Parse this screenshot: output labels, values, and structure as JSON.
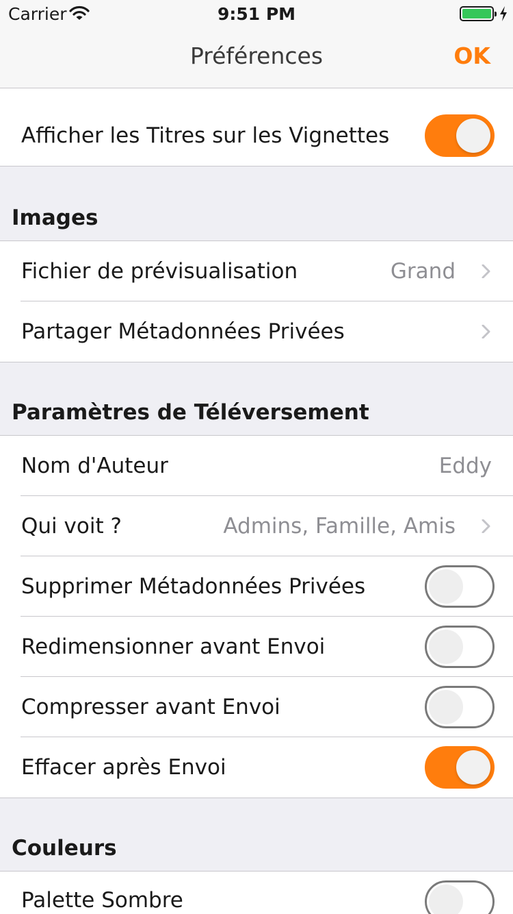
{
  "status_bar": {
    "carrier": "Carrier",
    "time": "9:51 PM",
    "battery_color": "#35c759"
  },
  "nav": {
    "title": "Préférences",
    "ok_label": "OK",
    "accent_color": "#ff7d0d"
  },
  "top_group": {
    "rows": [
      {
        "label": "Afficher les Titres sur les Vignettes",
        "toggle": true
      }
    ]
  },
  "images": {
    "header": "Images",
    "rows": [
      {
        "label": "Fichier de prévisualisation",
        "value": "Grand",
        "chevron": true
      },
      {
        "label": "Partager Métadonnées Privées",
        "chevron": true
      }
    ]
  },
  "upload": {
    "header": "Paramètres de Téléversement",
    "rows": [
      {
        "label": "Nom d'Auteur",
        "value": "Eddy"
      },
      {
        "label": "Qui voit ?",
        "value": "Admins, Famille, Amis",
        "chevron": true
      },
      {
        "label": "Supprimer Métadonnées Privées",
        "toggle": false
      },
      {
        "label": "Redimensionner avant Envoi",
        "toggle": false
      },
      {
        "label": "Compresser avant Envoi",
        "toggle": false
      },
      {
        "label": "Effacer après Envoi",
        "toggle": true
      }
    ]
  },
  "colors": {
    "header": "Couleurs",
    "rows": [
      {
        "label": "Palette Sombre",
        "toggle": false
      }
    ]
  }
}
